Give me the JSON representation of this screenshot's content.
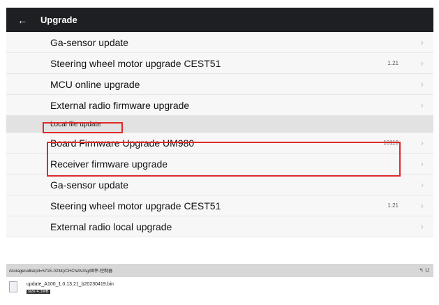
{
  "header": {
    "back_icon": "arrow-left-icon",
    "title": "Upgrade"
  },
  "rows": [
    {
      "label": "Ga-sensor update",
      "value": ""
    },
    {
      "label": "Steering wheel motor upgrade CEST51",
      "value": "1.21"
    },
    {
      "label": "MCU online upgrade",
      "value": ""
    },
    {
      "label": "External radio firmware upgrade",
      "value": ""
    }
  ],
  "section": {
    "label": "Local file update"
  },
  "local_rows": [
    {
      "label": "Board Firmware Upgrade  UM980",
      "value": "10110"
    },
    {
      "label": "Receiver firmware upgrade",
      "value": ""
    },
    {
      "label": "Ga-sensor update",
      "value": ""
    },
    {
      "label": "Steering wheel motor upgrade CEST51",
      "value": "1.21"
    },
    {
      "label": "External radio local upgrade",
      "value": ""
    }
  ],
  "chevron": "›",
  "filebrowser": {
    "path": "/storage/udisk(id=571E-0234)/CHCNAV/Ag/固件-控制器",
    "back_label": "↰ U",
    "file": {
      "name": "update_A100_1.0.13.21_b20230419.bin",
      "size": "size 4.1MB"
    }
  },
  "colors": {
    "topbar": "#1e1f22",
    "highlight": "#e0292a",
    "section_bg": "#e2e2e2"
  }
}
